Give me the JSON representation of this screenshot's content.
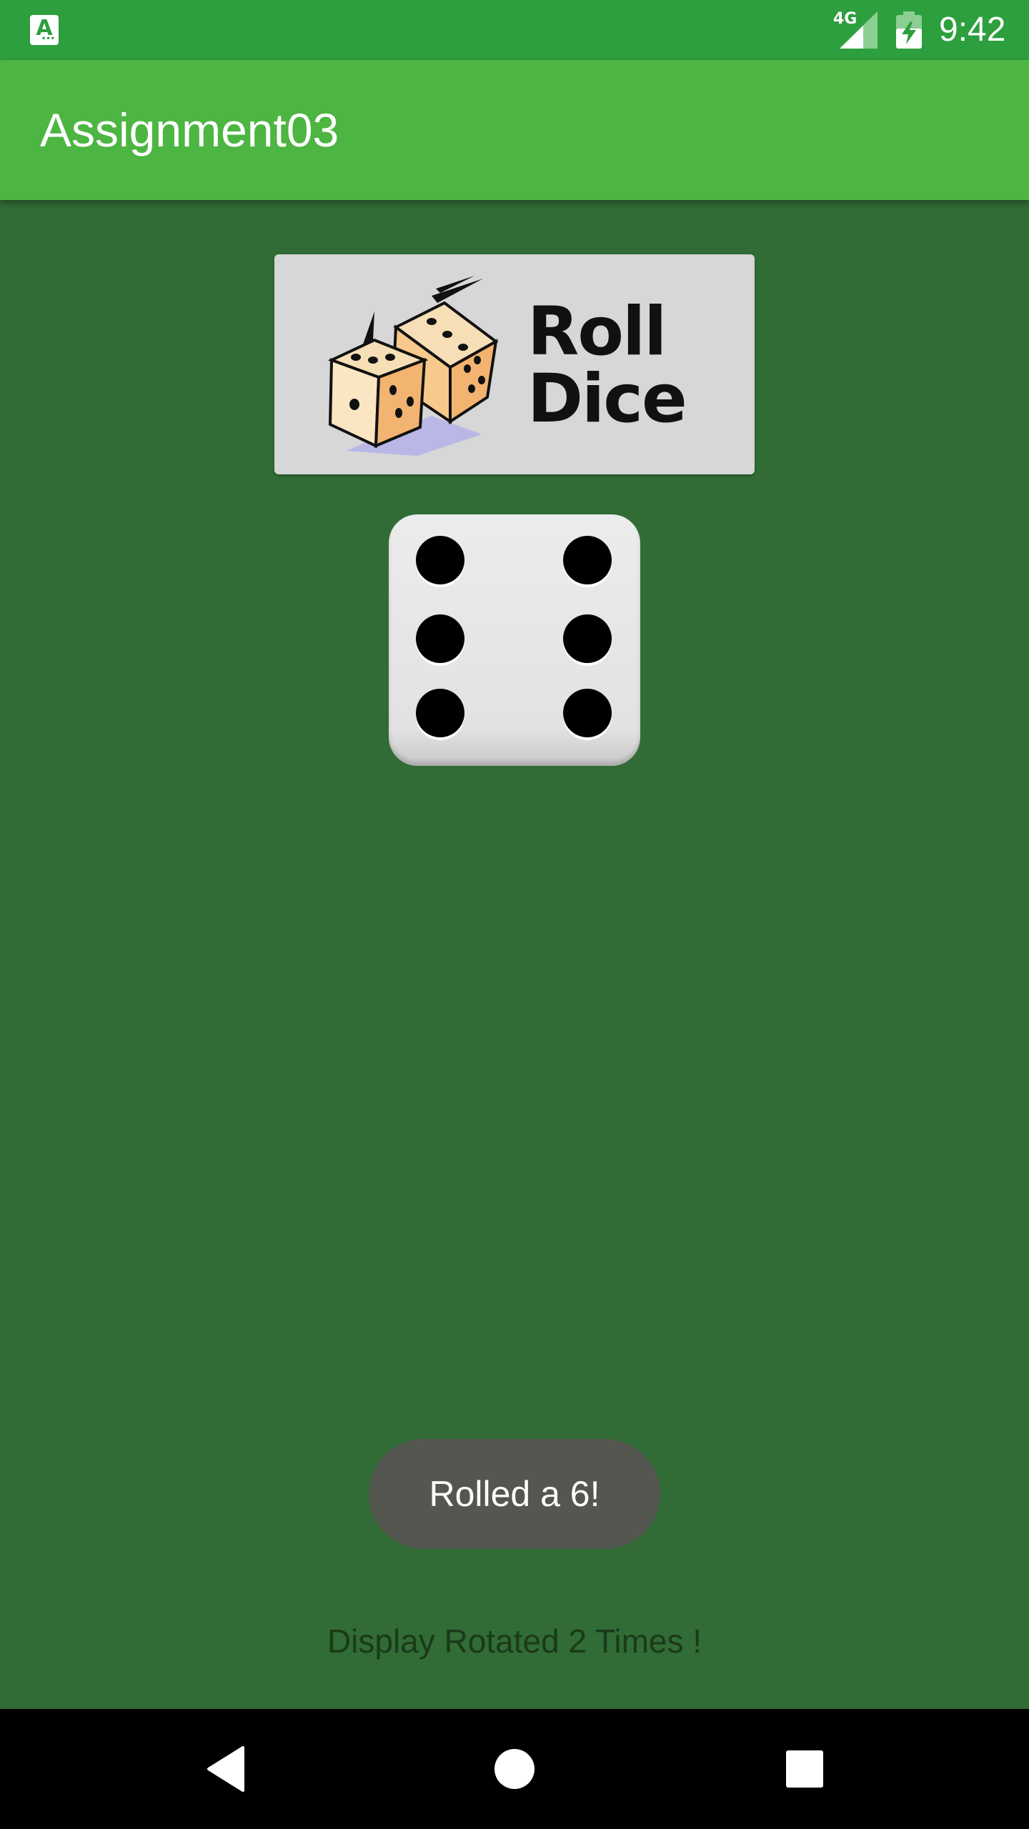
{
  "status_bar": {
    "time": "9:42",
    "network": "4G",
    "app_icon_letter": "A",
    "icons": [
      "app-notification-icon",
      "signal-icon",
      "battery-charging-icon"
    ]
  },
  "app_bar": {
    "title": "Assignment03"
  },
  "roll_button": {
    "line1": "Roll",
    "line2": "Dice"
  },
  "die": {
    "value": 6
  },
  "toast": {
    "message": "Rolled a 6!"
  },
  "rotation": {
    "text": "Display Rotated 2 Times !"
  },
  "nav_bar": {
    "icons": [
      "back-icon",
      "home-icon",
      "recents-icon"
    ]
  },
  "colors": {
    "status_bar": "#2d9f3e",
    "app_bar": "#4db541",
    "background": "#316b35",
    "toast": "#54574f"
  }
}
